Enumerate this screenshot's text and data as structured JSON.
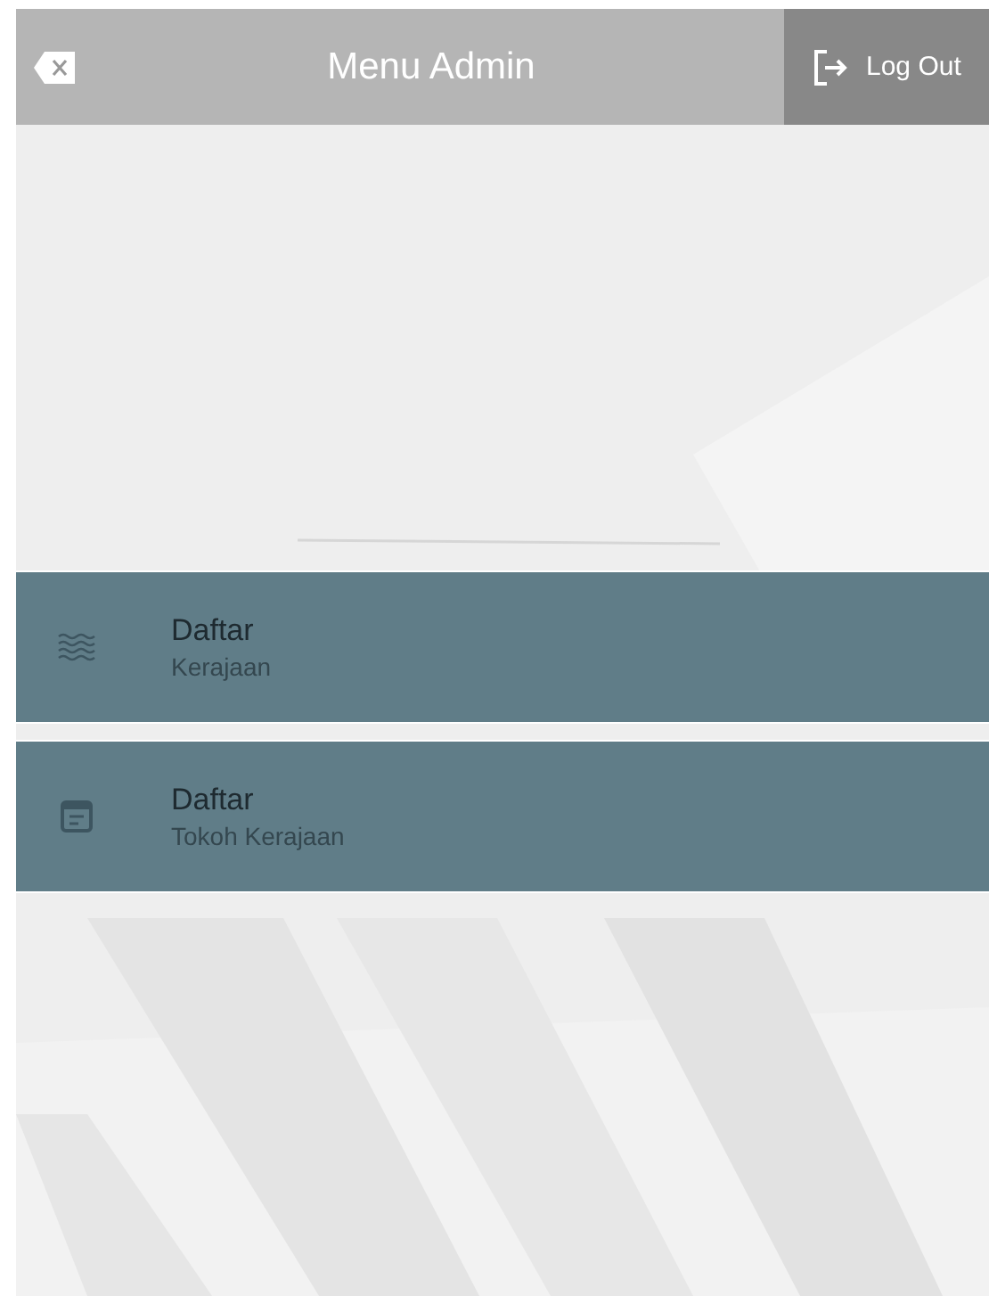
{
  "header": {
    "title": "Menu Admin",
    "logout": "Log Out"
  },
  "menu": [
    {
      "kind": "waves",
      "title": "Daftar",
      "subtitle": "Kerajaan"
    },
    {
      "kind": "list",
      "title": "Daftar",
      "subtitle": "Tokoh Kerajaan"
    }
  ]
}
